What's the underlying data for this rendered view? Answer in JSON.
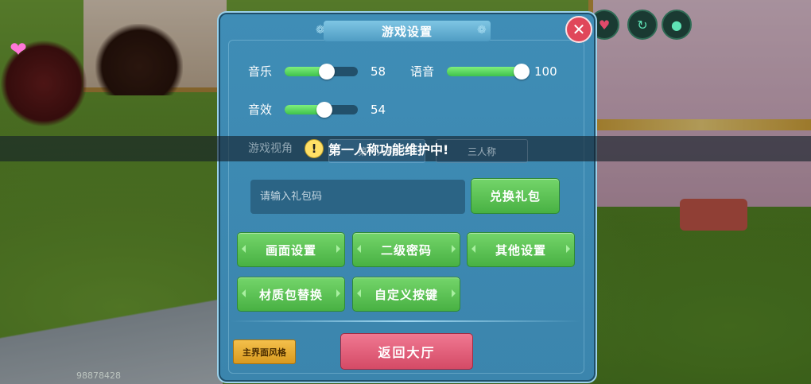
{
  "dialog": {
    "title": "游戏设置",
    "close_icon": "close-icon"
  },
  "sliders": [
    {
      "label": "音乐",
      "value": 58,
      "max": 100
    },
    {
      "label": "语音",
      "value": 100,
      "max": 100
    },
    {
      "label": "音效",
      "value": 54,
      "max": 100
    }
  ],
  "camera": {
    "label": "游戏视角",
    "option_first": "第一人称",
    "option_third": "三人称"
  },
  "notice": {
    "message": "第一人称功能维护中!",
    "icon": "warning-icon"
  },
  "gift": {
    "placeholder": "请输入礼包码",
    "redeem_label": "兑换礼包"
  },
  "menu_buttons": {
    "graphics": "画面设置",
    "second_password": "二级密码",
    "other": "其他设置",
    "texture_pack": "材质包替换",
    "custom_keys": "自定义按键"
  },
  "footer": {
    "ui_style": "主界面风格",
    "back_lobby": "返回大厅"
  },
  "player_id": "98878428",
  "hud_icons": [
    "heart-icon",
    "swap-icon",
    "drop-icon"
  ],
  "colors": {
    "panel": "#3f8db6",
    "button_green": "#48b143",
    "button_red": "#d44a66",
    "button_gold": "#d99a1f",
    "slider_fill": "#3fc24c"
  }
}
